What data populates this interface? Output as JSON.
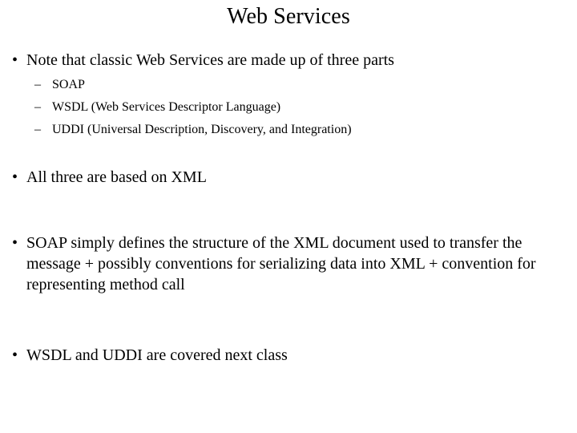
{
  "slide": {
    "title": "Web Services",
    "bullet_marker_level1": "•",
    "bullet_marker_level2": "–",
    "background_color": "#ffffff",
    "text_color": "#000000",
    "bullets": [
      {
        "text": "Note that classic Web Services are made up of three parts",
        "sub_bullets": [
          {
            "text": "SOAP"
          },
          {
            "text": "WSDL (Web Services Descriptor Language)"
          },
          {
            "text": "UDDI (Universal Description, Discovery, and Integration)"
          }
        ]
      },
      {
        "text": "All three are based on XML",
        "sub_bullets": []
      },
      {
        "text": "SOAP simply defines the structure of the XML document used to transfer the message + possibly conventions for serializing data into XML + convention for representing method call",
        "sub_bullets": []
      },
      {
        "text": "WSDL and UDDI are covered next class",
        "sub_bullets": []
      }
    ]
  }
}
